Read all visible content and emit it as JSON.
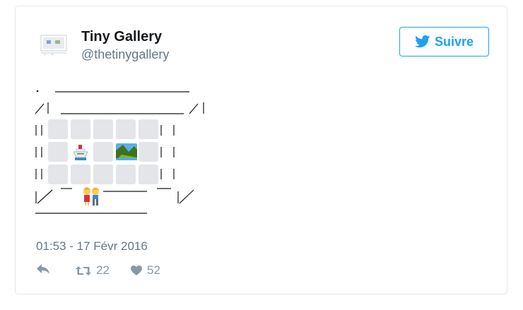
{
  "profile": {
    "display_name": "Tiny Gallery",
    "handle": "@thetinygallery",
    "avatar_icon": "gallery-thumbnail-icon"
  },
  "follow_button": {
    "label": "Suivre",
    "icon": "twitter-bird-icon",
    "color": "#1da1f2"
  },
  "tweet_art": {
    "line_top": ". ________________",
    "line_upper": "/| ______________ /|",
    "side_left": "| |",
    "side_right": "| |",
    "line_bottom_left": "|/",
    "line_bottom_right": "|/",
    "line_base": "________________",
    "cells": [
      [
        "",
        "",
        "",
        "",
        ""
      ],
      [
        "",
        "ship",
        "",
        "landscape",
        ""
      ],
      [
        "",
        "",
        "",
        "",
        ""
      ]
    ],
    "visitors_icon": "couple-icon"
  },
  "timestamp": "01:53 - 17 Févr 2016",
  "actions": {
    "reply_icon": "reply-icon",
    "retweet_icon": "retweet-icon",
    "retweet_count": "22",
    "like_icon": "heart-icon",
    "like_count": "52"
  }
}
